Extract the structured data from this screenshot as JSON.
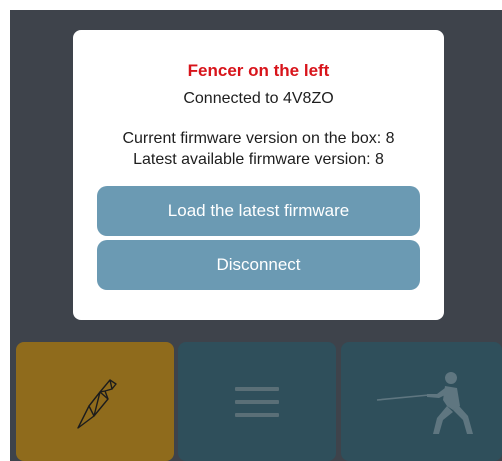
{
  "dialog": {
    "title": "Fencer on the left",
    "connection": "Connected to 4V8ZO",
    "current_firmware": "Current firmware version on the box: 8",
    "latest_firmware": "Latest available firmware version: 8",
    "load_button": "Load the latest firmware",
    "disconnect_button": "Disconnect"
  },
  "tabs": [
    {
      "icon": "origami-bird-icon"
    },
    {
      "icon": "menu-icon"
    },
    {
      "icon": "fencer-icon"
    }
  ],
  "colors": {
    "overlay": "#3e434b",
    "title": "#d8141b",
    "button": "#6b9ab3",
    "tab_active": "#8f6b1c",
    "tab_inactive": "#2f4f5b"
  }
}
